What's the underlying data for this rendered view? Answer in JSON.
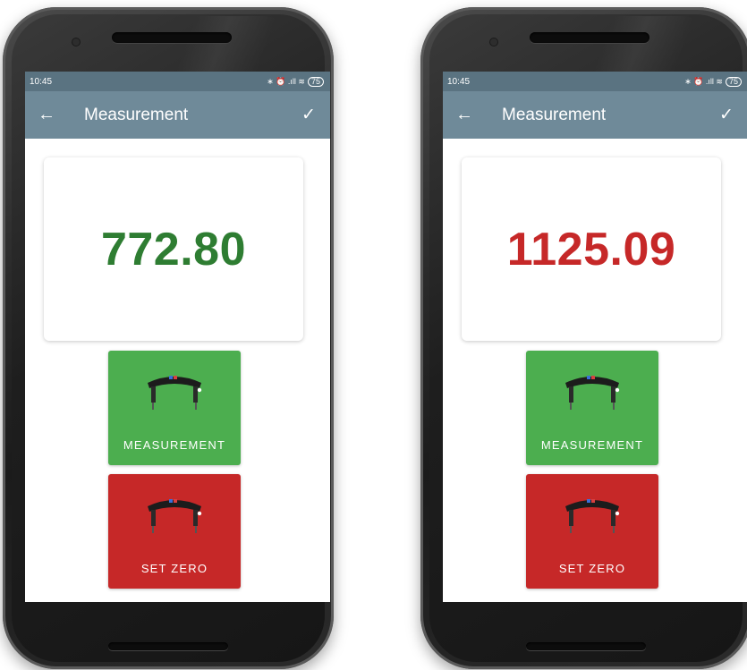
{
  "screens": [
    {
      "status": {
        "time": "10:45",
        "icons": "∗ ⏰ .ıll ≋",
        "battery": "75"
      },
      "appbar": {
        "title": "Measurement",
        "back_icon": "arrow-left-icon",
        "confirm_icon": "check-icon"
      },
      "reading": {
        "value": "772.80",
        "color": "#2e7d32"
      },
      "buttons": {
        "measure_label": "MEASUREMENT",
        "zero_label": "SET ZERO"
      }
    },
    {
      "status": {
        "time": "10:45",
        "icons": "∗ ⏰ .ıll ≋",
        "battery": "75"
      },
      "appbar": {
        "title": "Measurement",
        "back_icon": "arrow-left-icon",
        "confirm_icon": "check-icon"
      },
      "reading": {
        "value": "1125.09",
        "color": "#c62828"
      },
      "buttons": {
        "measure_label": "MEASUREMENT",
        "zero_label": "SET ZERO"
      }
    }
  ],
  "colors": {
    "statusbar": "#5a7381",
    "appbar": "#6f8a99",
    "measure_button": "#4cae4f",
    "zero_button": "#c62828"
  }
}
